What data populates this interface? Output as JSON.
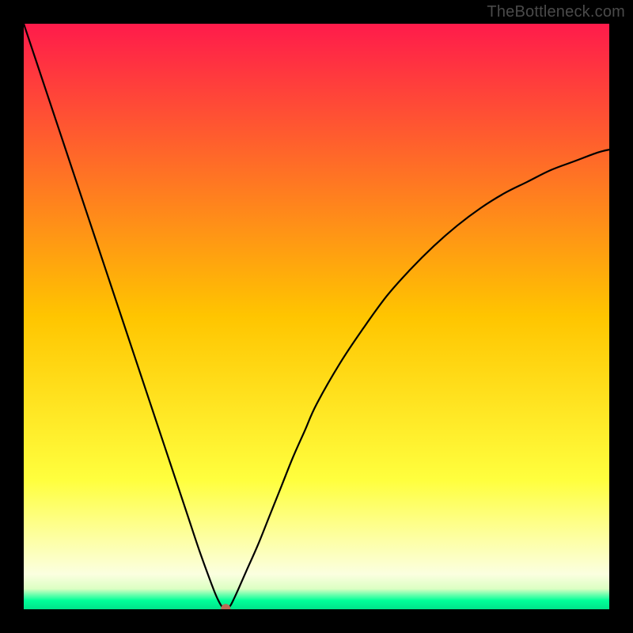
{
  "watermark": "TheBottleneck.com",
  "chart_data": {
    "type": "line",
    "title": "",
    "xlabel": "",
    "ylabel": "",
    "xlim": [
      0,
      100
    ],
    "ylim": [
      0,
      100
    ],
    "grid": false,
    "legend": false,
    "background_gradient": {
      "stops": [
        {
          "offset": 0.0,
          "color": "#ff1b4b"
        },
        {
          "offset": 0.5,
          "color": "#ffc500"
        },
        {
          "offset": 0.78,
          "color": "#ffff3e"
        },
        {
          "offset": 0.88,
          "color": "#fdffa4"
        },
        {
          "offset": 0.94,
          "color": "#fbffe0"
        },
        {
          "offset": 0.965,
          "color": "#dcffc3"
        },
        {
          "offset": 0.985,
          "color": "#00ff99"
        },
        {
          "offset": 1.0,
          "color": "#00e38a"
        }
      ]
    },
    "series": [
      {
        "name": "bottleneck-curve",
        "color": "#000000",
        "x": [
          0,
          2,
          4,
          6,
          8,
          10,
          12,
          14,
          16,
          18,
          20,
          22,
          24,
          26,
          28,
          30,
          32,
          33,
          34,
          35,
          36,
          38,
          40,
          42,
          44,
          46,
          48,
          50,
          54,
          58,
          62,
          66,
          70,
          74,
          78,
          82,
          86,
          90,
          94,
          98,
          100
        ],
        "y": [
          100,
          94,
          88,
          82,
          76,
          70,
          64,
          58,
          52,
          46,
          40,
          34,
          28,
          22,
          16,
          10,
          4.5,
          2,
          0.3,
          0.3,
          2,
          6.5,
          11,
          16,
          21,
          26,
          30.5,
          35,
          42,
          48,
          53.5,
          58,
          62,
          65.5,
          68.5,
          71,
          73,
          75,
          76.5,
          78,
          78.5
        ]
      }
    ],
    "marker": {
      "x": 34.5,
      "y": 0.1,
      "color": "#b96a55",
      "size": 6
    }
  }
}
